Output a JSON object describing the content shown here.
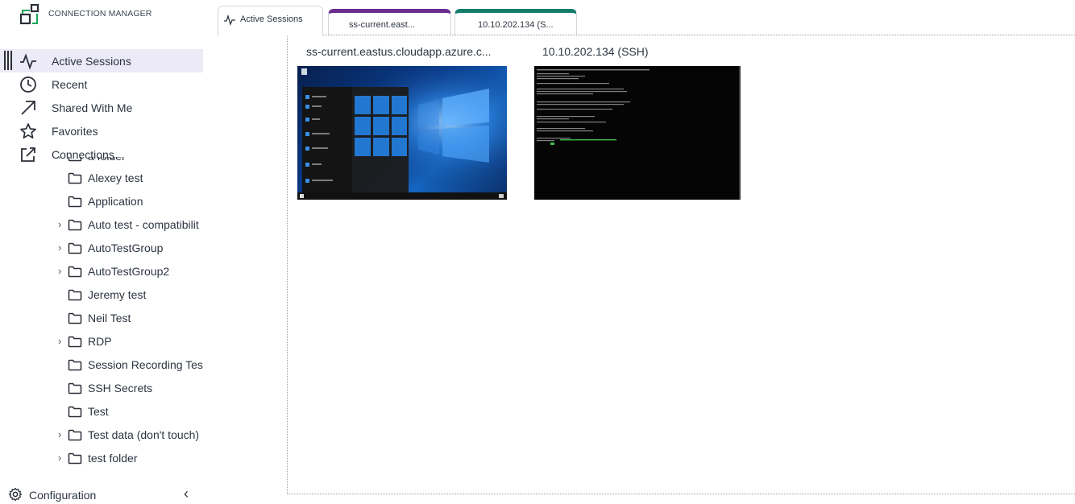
{
  "app": {
    "title": "CONNECTION MANAGER"
  },
  "nav": [
    {
      "label": "Active Sessions",
      "icon": "pulse-icon",
      "active": true
    },
    {
      "label": "Recent",
      "icon": "clock-icon"
    },
    {
      "label": "Shared With Me",
      "icon": "arrow-up-right-icon"
    },
    {
      "label": "Favorites",
      "icon": "star-icon"
    },
    {
      "label": "Connections",
      "icon": "external-link-icon"
    }
  ],
  "tree": [
    {
      "label": "a folder",
      "expandable": true,
      "partial": true
    },
    {
      "label": "Alexey test",
      "expandable": false
    },
    {
      "label": "Application",
      "expandable": false
    },
    {
      "label": "Auto test - compatibilit",
      "expandable": true
    },
    {
      "label": "AutoTestGroup",
      "expandable": true
    },
    {
      "label": "AutoTestGroup2",
      "expandable": true
    },
    {
      "label": "Jeremy test",
      "expandable": false
    },
    {
      "label": "Neil Test",
      "expandable": false
    },
    {
      "label": "RDP",
      "expandable": true
    },
    {
      "label": "Session Recording Test",
      "expandable": false
    },
    {
      "label": "SSH Secrets",
      "expandable": false
    },
    {
      "label": "Test",
      "expandable": false
    },
    {
      "label": "Test data (don't touch)",
      "expandable": true
    },
    {
      "label": "test folder",
      "expandable": true
    }
  ],
  "footer": {
    "config_label": "Configuration",
    "collapse_glyph": "‹"
  },
  "tabs": [
    {
      "label": "Active Sessions",
      "icon": "pulse-icon"
    },
    {
      "label": "ss-current.east...",
      "accent": "#6b2c8e"
    },
    {
      "label": "10.10.202.134 (S...",
      "accent": "#137d6e"
    }
  ],
  "sessions": [
    {
      "title": "ss-current.eastus.cloudapp.azure.c...",
      "type": "rdp"
    },
    {
      "title": "10.10.202.134 (SSH)",
      "type": "ssh"
    }
  ],
  "colors": {
    "brand_green": "#1aa35b",
    "active_bg": "#eceaf7",
    "text": "#2c3440"
  }
}
